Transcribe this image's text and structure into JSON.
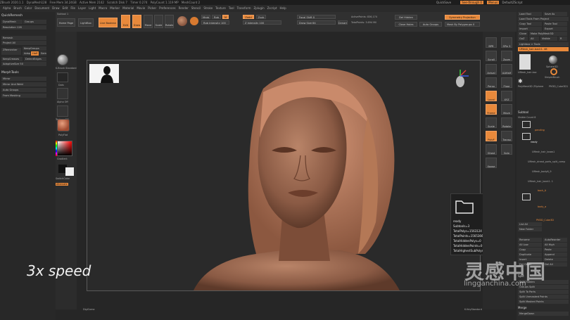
{
  "title_bar": {
    "app": "ZBrush 2020.1.1",
    "items": [
      "DynaMesh128",
      "Free Mem 34.24GB",
      "Active Mem 2142",
      "Scratch Disk 7",
      "Timer 0.274",
      "PolyCount 1.119 MP",
      "MeshCount 2"
    ],
    "right_items": [
      "QuickSave",
      "See-through 0",
      "Menus",
      "DefaultZScript"
    ]
  },
  "menu": [
    "Alpha",
    "Brush",
    "Color",
    "Document",
    "Draw",
    "Edit",
    "File",
    "Layer",
    "Light",
    "Macro",
    "Marker",
    "Material",
    "Movie",
    "Picker",
    "Preferences",
    "Render",
    "Stencil",
    "Stroke",
    "Texture",
    "Tool",
    "Transform",
    "Zplugin",
    "Zscript",
    "Help"
  ],
  "left_panel": {
    "title": "QuickRemesh",
    "dynamesh": "DynaMesh",
    "groups": "Groups",
    "resolution": "Resolution 128",
    "remesh": "Remesh",
    "project": "Project All",
    "zremesher": "ZRemesher",
    "keepgroups": "KeepGroups",
    "adapt": "Adapt",
    "half": "Half",
    "same": "Same",
    "keep_creases": "KeepCreases",
    "detect_edges": "DetectEdges",
    "adaptive_size": "AdaptiveSize 50",
    "morph_title": "MorphTools",
    "mirror": "Mirror",
    "mirror_weld": "Mirror And Weld",
    "auto_groups": "Auto Groups",
    "from_masking": "From Masking"
  },
  "shelf": {
    "subtool_label": "Subtool 1",
    "home_page": "Home Page",
    "lightbox": "LightBox",
    "live_boolean": "Live Boolean",
    "edit": "Edit",
    "draw": "Draw",
    "move": "Move",
    "scale": "Scale",
    "rotate": "Rotate",
    "mrgb": "Mrgb",
    "rgb": "Rgb",
    "m": "M",
    "zadd": "Zadd",
    "zsub": "Zsub",
    "rgb_intensity": "Rgb Intensity 100",
    "z_intensity": "Z Intensity 100",
    "focal_shift": "Focal Shift 0",
    "draw_size": "Draw Size 64",
    "dynamic": "Dynamic",
    "active_points": "ActivePoints: 836,174",
    "total_points": "TotalPoints: 3.694 Mil",
    "dot_hidden": "Del Hidden",
    "close_holes": "Close Holes",
    "auto_groups": "Auto Groups",
    "sym_proj": "Symmetry Projection",
    "mask_by_poly": "Mask By Polygroups 0"
  },
  "canvas_left": {
    "brush": "K.Brush Standard",
    "stroke": "Dots",
    "alpha": "Alpha Off",
    "texture": "Texture Off",
    "material": "PolyFlat",
    "gradient": "Gradient",
    "switch": "SwitchColor",
    "alternate": "Alternate"
  },
  "viewport": {
    "bottom_left": "DigiComa",
    "bottom_right": "K.KeyStandard"
  },
  "right_tools": [
    "BPR",
    "SPix 3",
    "Scroll",
    "Zoom",
    "Actual",
    "AAHalf",
    "Persp",
    "Floor",
    "Local",
    "XYZ",
    "Frame",
    "Move",
    "Scale",
    "Rotate",
    "PolyF",
    "Transp",
    "Ghost",
    "Solo",
    "Xpose"
  ],
  "right_panel": {
    "load_tool": "Load Tool",
    "save_as": "Save As",
    "load_from_project": "Load Tools From Project",
    "copy_tool": "Copy Tool",
    "paste_tool": "Paste Tool",
    "import": "Import",
    "export": "Export",
    "clone": "Clone",
    "make_polymesh": "Make PolyMesh3D",
    "goz": "GoZ",
    "all": "All",
    "visible": "Visible",
    "r": "R",
    "lightbox_tools": "Lightbox > Tools",
    "current_tool": "UMesh_hair-back1. 48",
    "tool_names": [
      "UMesh_hair-bac",
      "Sphere3D",
      "SimpleBrush",
      "PolyMesh3D",
      "ZSphere",
      "PM3D_Cube3D1"
    ],
    "subtool_title": "Subtool",
    "visible_count": "Visible Count 8",
    "subtools": [
      "pending",
      "ready",
      "UMesh_hair_bows1",
      "UMesh_dread_parts_split_comp",
      "UMesh_body6_9",
      "UMesh_hair_back1. 1",
      "back_A",
      "body_a",
      "PM3D_Cube3D"
    ],
    "list_all": "List All",
    "new_folder": "New Folder",
    "rename": "Rename",
    "autoreorder": "AutoReorder",
    "all_low": "All Low",
    "all_high": "All High",
    "copy": "Copy",
    "paste": "Paste",
    "duplicate": "Duplicate",
    "append": "Append",
    "insert": "Insert",
    "delete": "Delete",
    "del_other": "Del Other",
    "del_all": "Del All",
    "split": "Split",
    "split_hidden": "Split Hidden",
    "groups_split": "Groups Split",
    "split_to_parts": "Split To Parts",
    "split_unmasked": "Split Unmasked Points",
    "split_masked": "Split Masked Points",
    "merge": "Merge",
    "merge_down": "MergeDown"
  },
  "info": {
    "name": "ready",
    "subtools": "Subtools=3",
    "total_polys": "TotalPolys=1563124",
    "total_points": "TotalPoints=1565366",
    "hidden_polys": "TotalHiddenPolys=0",
    "hidden_points": "TotalHiddenPoints=0",
    "highest": "TotalHighestSubPolys=0.000000 Mil"
  },
  "overlay": {
    "speed": "3x speed",
    "watermark_cn": "灵感中国",
    "watermark_url": "lingganchina.com"
  },
  "colors": {
    "accent": "#e8893b",
    "skin": "#b97a5f",
    "bg": "#262626"
  }
}
